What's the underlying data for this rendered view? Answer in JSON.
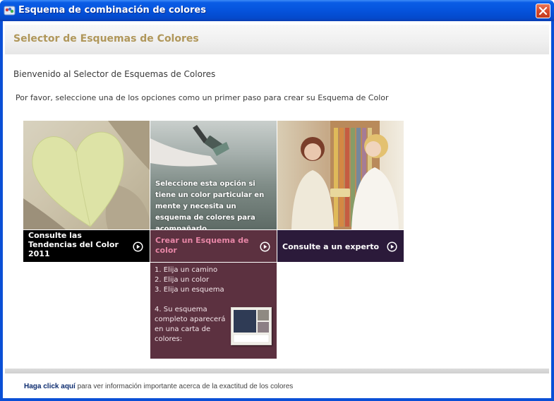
{
  "window": {
    "title": "Esquema de combinación de colores"
  },
  "header": {
    "title": "Selector de Esquemas de Colores"
  },
  "main": {
    "welcome": "Bienvenido al Selector de Esquemas de Colores",
    "instruction": "Por favor, seleccione una de los opciones como un primer paso para crear su Esquema de Color"
  },
  "tiles": [
    {
      "label": "Consulte las Tendencias del Color 2011",
      "icon": "play-circle-icon"
    },
    {
      "label": "Crear un Esquema de color",
      "icon": "play-circle-icon",
      "overlay": "Seleccione esta opción si tiene un color particular en mente y necesita un esquema de colores para acompañarlo"
    },
    {
      "label": "Consulte a un experto",
      "icon": "play-circle-icon"
    }
  ],
  "steps": {
    "step1": "1. Elija un camino",
    "step2": "2. Elija un color",
    "step3": "3. Elija un esquema",
    "step4": "4. Su esquema completo aparecerá en una carta de colores:"
  },
  "footer": {
    "link": "Haga click aquí",
    "text": " para ver información importante acerca de la exactitud de los colores"
  },
  "colors": {
    "titlebar": "#0553dc",
    "header_title": "#b0975a",
    "tile1_label_bg": "#000000",
    "tile2_label_bg": "#5c3140",
    "tile2_label_text": "#e786a6",
    "tile3_label_bg": "#2b1a3a"
  }
}
